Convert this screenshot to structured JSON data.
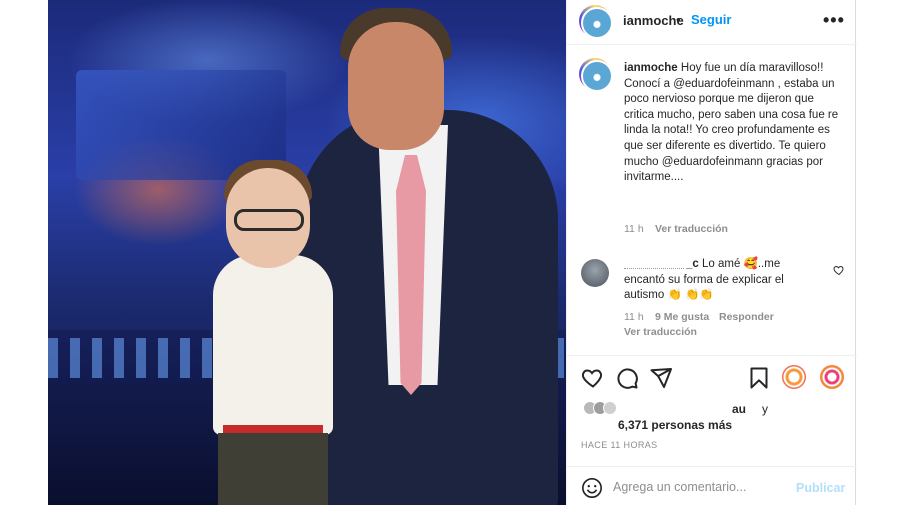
{
  "post": {
    "username": "ianmoche",
    "separator": "•",
    "follow_label": "Seguir",
    "more_label": "•••",
    "caption_before": " Hoy fue un día maravilloso!! Conocí a ",
    "mention_1": "@eduardofeinmann",
    "caption_middle": " , estaba un poco nervioso porque me dijeron que critica mucho, pero saben una cosa fue re linda la nota!! Yo creo profundamente es que ser diferente es divertido. Te quiero mucho ",
    "mention_2": "@eduardofeinmann",
    "caption_after": " gracias por invitarme....",
    "caption_time": "11 h",
    "see_translation": "Ver traducción"
  },
  "comment": {
    "user_suffix": "_c",
    "text": " Lo amé 🥰..me encantó su forma de explicar el autismo 👏 👏👏",
    "time": "11 h",
    "likes": "9 Me gusta",
    "reply": "Responder",
    "see_translation": "Ver traducción"
  },
  "likes": {
    "top_users": "au",
    "connector": "y",
    "count_text": "6,371 personas más",
    "post_time": "HACE 11 HORAS"
  },
  "composer": {
    "placeholder": "Agrega un comentario...",
    "publish_label": "Publicar"
  },
  "icons": {
    "like": "heart-icon",
    "comment": "comment-icon",
    "share": "share-icon",
    "save": "bookmark-icon",
    "emoji": "smiley-icon"
  },
  "colors": {
    "link": "#0095f6",
    "muted": "#8e8e8e",
    "publish_disabled": "#b2dffc",
    "text": "#262626"
  }
}
